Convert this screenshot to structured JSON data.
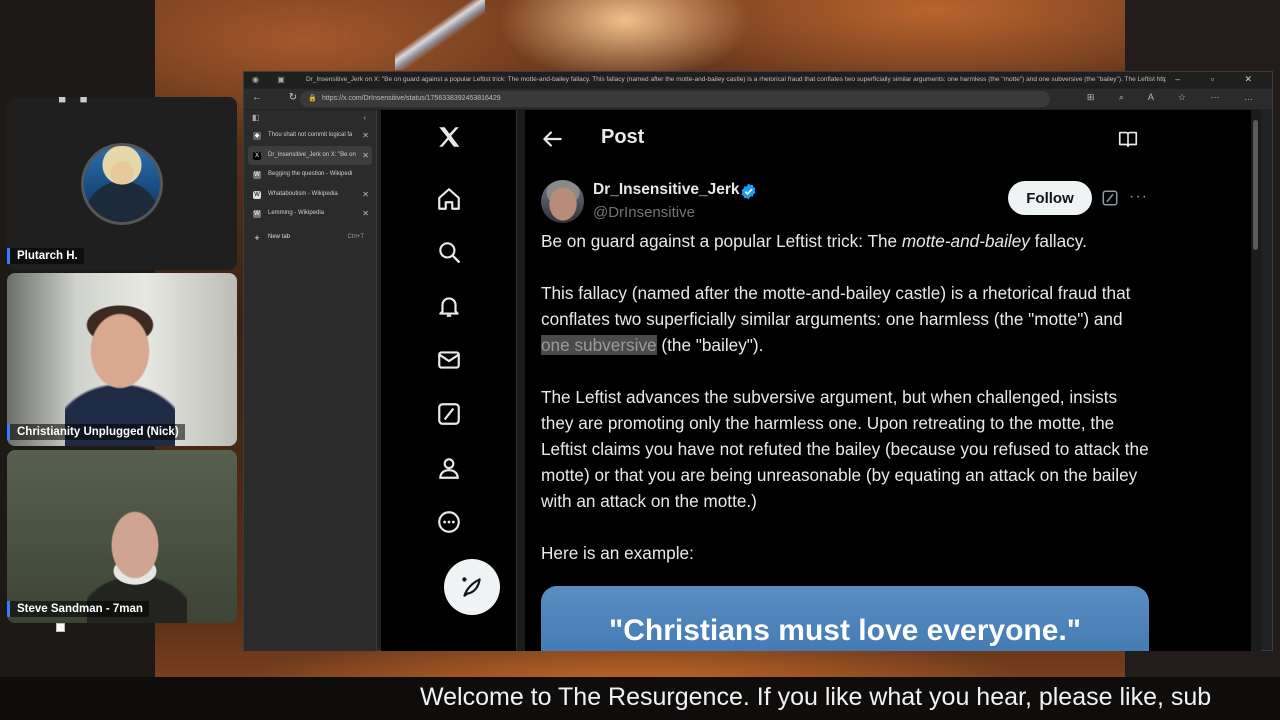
{
  "stream": {
    "caption": "Welcome to The Resurgence. If you like what you hear, please like, sub"
  },
  "participants": [
    {
      "name": "Plutarch H."
    },
    {
      "name": "Christianity Unplugged (Nick)"
    },
    {
      "name": "Steve Sandman - 7man"
    }
  ],
  "browser": {
    "window_title": "Dr_Insensitive_Jerk on X: \"Be on guard against a popular Leftist trick: The motte-and-bailey fallacy. This fallacy (named after the motte-and-bailey castle) is a rhetorical fraud that conflates two superficially similar arguments: one harmless (the \"motte\") and one subversive (the \"bailey\"). The Leftist https://t.co/zim...",
    "url": "https://x.com/DrInsensitive/status/1756338392453816429",
    "tabs": [
      {
        "label": "Thou shalt not commit logical fa",
        "favicon": "shield-icon"
      },
      {
        "label": "Dr_Insensitive_Jerk on X: \"Be on",
        "favicon": "x-logo-icon"
      },
      {
        "label": "Begging the question - Wikipedi",
        "favicon": "wikipedia-icon"
      },
      {
        "label": "Whataboutism - Wikipedia",
        "favicon": "wikipedia-icon"
      },
      {
        "label": "Lemming - Wikipedia",
        "favicon": "wikipedia-icon"
      }
    ],
    "new_tab": {
      "label": "New tab",
      "shortcut": "Ctrl+T"
    }
  },
  "x": {
    "header_title": "Post",
    "author": {
      "name": "Dr_Insensitive_Jerk",
      "handle": "@DrInsensitive",
      "verified": true
    },
    "follow_label": "Follow",
    "post": {
      "p1_before": "Be on guard against a popular Leftist trick: The ",
      "p1_em": "motte-and-bailey",
      "p1_after": " fallacy.",
      "p2_before": "This fallacy (named after the motte-and-bailey castle) is a rhetorical fraud that conflates two superficially similar arguments: one harmless (the \"motte\") and ",
      "p2_highlight": "one subversive",
      "p2_after": " (the \"bailey\").",
      "p3": "The Leftist advances the subversive argument, but when challenged, insists they are promoting only the harmless one. Upon retreating to the motte, the Leftist claims you have not refuted the bailey (because you refused to attack the motte) or that you are being unreasonable (by equating an attack on the bailey with an attack on the motte.)",
      "p4": "Here is an example:"
    },
    "quote_image_text": "\"Christians must love everyone.\"",
    "colors": {
      "background": "#000000",
      "text": "#e7e9ea",
      "handle": "#71767b",
      "verified": "#1d9bf0",
      "quote_card": "#4a82bb"
    }
  }
}
